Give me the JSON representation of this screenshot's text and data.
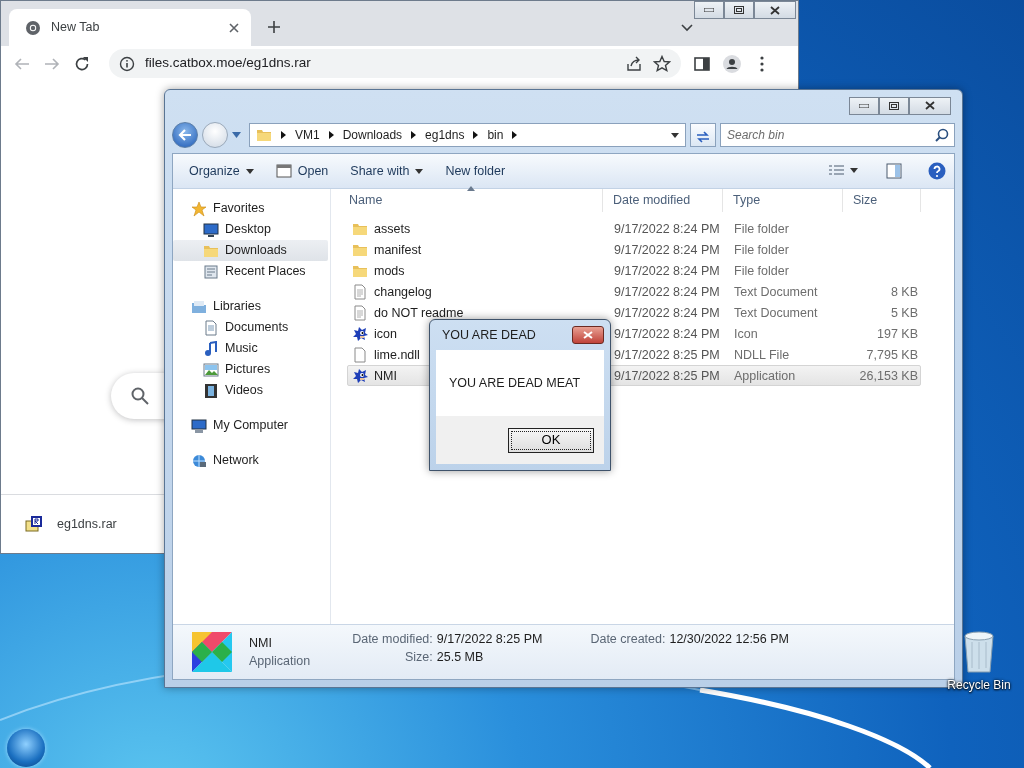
{
  "browser": {
    "tab": {
      "title": "New Tab",
      "selected": true
    },
    "url": "files.catbox.moe/eg1dns.rar",
    "download": {
      "filename": "eg1dns.rar"
    }
  },
  "explorer": {
    "breadcrumb": [
      "VM1",
      "Downloads",
      "eg1dns",
      "bin"
    ],
    "search": {
      "placeholder": "Search bin"
    },
    "toolbar": [
      {
        "label": "Organize",
        "dropdown": true
      },
      {
        "label": "Open",
        "dropdown": false
      },
      {
        "label": "Share with",
        "dropdown": true
      },
      {
        "label": "New folder",
        "dropdown": false
      }
    ],
    "nav": [
      {
        "label": "Favorites",
        "selected": false,
        "children": [
          {
            "label": "Desktop",
            "selected": false
          },
          {
            "label": "Downloads",
            "selected": true
          },
          {
            "label": "Recent Places",
            "selected": false
          }
        ]
      },
      {
        "label": "Libraries",
        "selected": false,
        "children": [
          {
            "label": "Documents",
            "selected": false
          },
          {
            "label": "Music",
            "selected": false
          },
          {
            "label": "Pictures",
            "selected": false
          },
          {
            "label": "Videos",
            "selected": false
          }
        ]
      },
      {
        "label": "My Computer",
        "selected": false
      },
      {
        "label": "Network",
        "selected": false
      }
    ],
    "columns": [
      "Name",
      "Date modified",
      "Type",
      "Size"
    ],
    "rows": [
      {
        "name": "assets",
        "date": "9/17/2022 8:24 PM",
        "type": "File folder",
        "kind": "folder",
        "selected": false
      },
      {
        "name": "manifest",
        "date": "9/17/2022 8:24 PM",
        "type": "File folder",
        "kind": "folder",
        "selected": false
      },
      {
        "name": "mods",
        "date": "9/17/2022 8:24 PM",
        "type": "File folder",
        "kind": "folder",
        "selected": false
      },
      {
        "name": "changelog",
        "date": "9/17/2022 8:24 PM",
        "type": "Text Document",
        "size": "8 KB",
        "kind": "text",
        "selected": false
      },
      {
        "name": "do NOT readme",
        "date": "9/17/2022 8:24 PM",
        "type": "Text Document",
        "size": "5 KB",
        "kind": "text",
        "selected": false
      },
      {
        "name": "icon",
        "date": "9/17/2022 8:24 PM",
        "type": "Icon",
        "size": "197 KB",
        "kind": "sprite",
        "selected": false
      },
      {
        "name": "lime.ndll",
        "date": "9/17/2022 8:25 PM",
        "type": "NDLL File",
        "size": "7,795 KB",
        "kind": "file",
        "selected": false
      },
      {
        "name": "NMI",
        "date": "9/17/2022 8:25 PM",
        "type": "Application",
        "size": "26,153 KB",
        "kind": "sprite",
        "selected": true
      }
    ],
    "details": {
      "name": "NMI",
      "type": "Application",
      "fields": [
        {
          "label": "Date modified:",
          "value": "9/17/2022 8:25 PM"
        },
        {
          "label": "Size:",
          "value": "25.5 MB"
        },
        {
          "label": "Date created:",
          "value": "12/30/2022 12:56 PM"
        }
      ]
    }
  },
  "dialog": {
    "title": "YOU ARE DEAD",
    "message": "YOU ARE DEAD MEAT",
    "button": "OK"
  },
  "desktop": {
    "icons": [
      {
        "label": "Recycle Bin"
      }
    ]
  }
}
